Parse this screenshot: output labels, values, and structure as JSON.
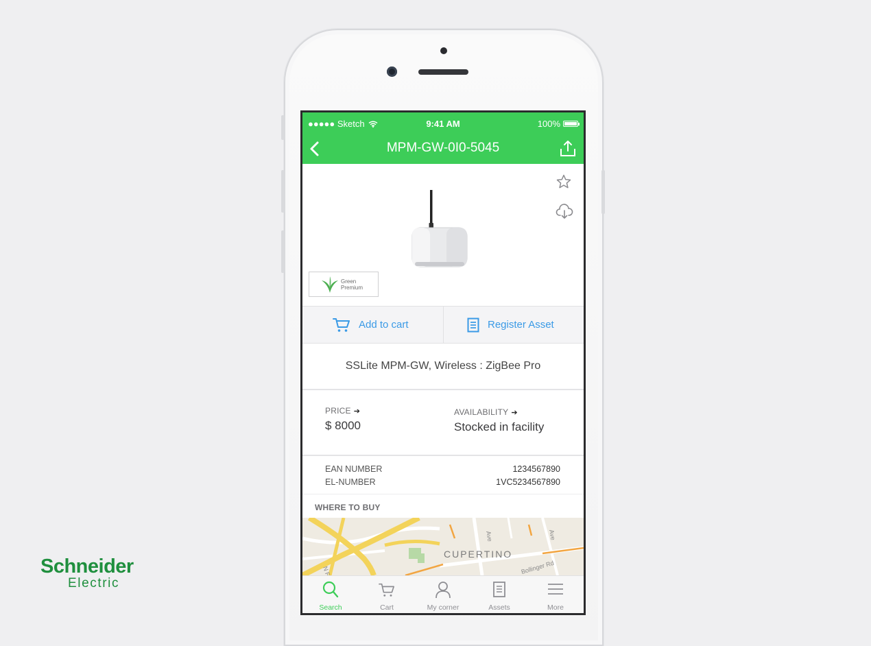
{
  "status_bar": {
    "carrier": "●●●●● Sketch",
    "time": "9:41 AM",
    "battery": "100%"
  },
  "nav": {
    "title": "MPM-GW-0I0-5045",
    "back_icon": "chevron-left-icon",
    "share_icon": "share-icon"
  },
  "product": {
    "badge_line1": "Green",
    "badge_line2": "Premium",
    "favorite_icon": "star-icon",
    "download_icon": "cloud-download-icon"
  },
  "actions": {
    "add_to_cart": "Add to cart",
    "register_asset": "Register Asset"
  },
  "description": "SSLite MPM-GW, Wireless : ZigBee Pro",
  "price": {
    "label": "PRICE",
    "value": "$ 8000"
  },
  "availability": {
    "label": "AVAILABILITY",
    "value": "Stocked in facility"
  },
  "numbers": {
    "ean_label": "EAN NUMBER",
    "ean_value": "1234567890",
    "el_label": "EL-NUMBER",
    "el_value": "1VC5234567890"
  },
  "where_to_buy": "WHERE TO BUY",
  "map": {
    "city": "CUPERTINO",
    "street1": "Ave",
    "street2": "Ave",
    "street3": "Ave",
    "street4": "Bollinger Rd",
    "street5": "N F"
  },
  "tabs": [
    {
      "label": "Search",
      "icon": "search-icon",
      "active": true
    },
    {
      "label": "Cart",
      "icon": "cart-icon",
      "active": false
    },
    {
      "label": "My corner",
      "icon": "person-icon",
      "active": false
    },
    {
      "label": "Assets",
      "icon": "document-icon",
      "active": false
    },
    {
      "label": "More",
      "icon": "menu-icon",
      "active": false
    }
  ],
  "brand": {
    "name_top": "Schneider",
    "name_bottom": "Electric",
    "color": "#1f8f3e"
  },
  "colors": {
    "accent": "#3dcd58",
    "link": "#3a9ae6"
  }
}
